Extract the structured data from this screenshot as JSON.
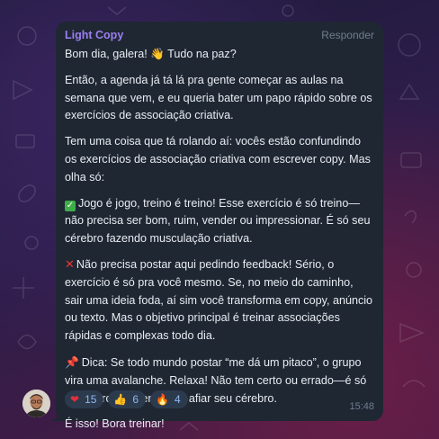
{
  "chat": {
    "sender_name": "Light Copy",
    "action_label": "Responder",
    "message": {
      "greeting": "Bom dia, galera! 👋 Tudo na paz?",
      "greeting_before": "Bom dia, galera! ",
      "greeting_after": " Tudo na paz?",
      "p1": "Então, a agenda já tá lá pra gente começar as aulas na semana que vem, e eu queria bater um papo rápido sobre os exercícios de associação criativa.",
      "p2": "Tem uma coisa que tá rolando aí: vocês estão confundindo os exercícios de associação criativa com escrever copy. Mas olha só:",
      "p3": "Jogo é jogo, treino é treino! Esse exercício é só treino—não precisa ser bom, ruim, vender ou impressionar. É só seu cérebro fazendo musculação criativa.",
      "p4": "Não precisa postar aqui pedindo feedback! Sério, o exercício é só pra você mesmo. Se, no meio do caminho, sair uma ideia foda, aí sim você transforma em copy, anúncio ou texto. Mas o objetivo principal é treinar associações rápidas e complexas todo dia.",
      "p5": "Dica: Se todo mundo postar “me dá um pitaco”, o grupo vira uma avalanche. Relaxa! Não tem certo ou errado—é só um exercício mental pra afiar seu cérebro.",
      "p6": "É isso! Bora treinar!"
    },
    "icons": {
      "greeting": "waving-hand-emoji",
      "p3": "check-mark-emoji",
      "p4": "cross-mark-emoji",
      "p5": "pushpin-emoji"
    },
    "reactions": [
      {
        "emoji": "heart",
        "count": "15"
      },
      {
        "emoji": "thumbs-up",
        "count": "6"
      },
      {
        "emoji": "fire",
        "count": "4"
      }
    ],
    "time": "15:48"
  },
  "colors": {
    "sender": "#9b7ef0",
    "bubble": "#1f2733",
    "reaction_bg": "#2c3a4d"
  }
}
